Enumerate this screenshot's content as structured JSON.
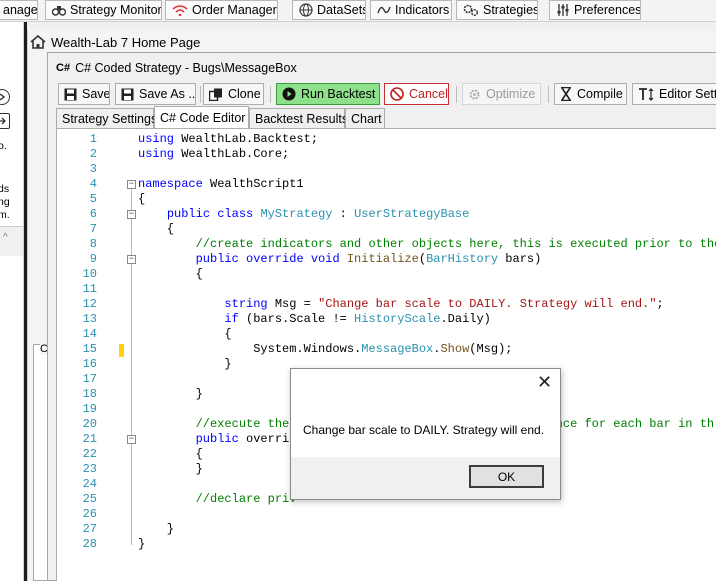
{
  "toolbar": [
    {
      "id": "order-manager-partial",
      "label": "anager",
      "icon": "none"
    },
    {
      "id": "strategy-monitor",
      "label": "Strategy Monitor",
      "icon": "binoculars-icon"
    },
    {
      "id": "order-manager",
      "label": "Order Manager",
      "icon": "wifi-icon"
    },
    {
      "id": "datasets",
      "label": "DataSets",
      "icon": "globe-icon"
    },
    {
      "id": "indicators",
      "label": "Indicators",
      "icon": "wave-icon"
    },
    {
      "id": "strategies",
      "label": "Strategies",
      "icon": "gears-icon"
    },
    {
      "id": "preferences",
      "label": "Preferences",
      "icon": "sliders-icon"
    }
  ],
  "left_panel": {
    "text_lines": [
      "o.",
      "ds",
      "ng",
      "m."
    ]
  },
  "home": {
    "title": "Wealth-Lab 7 Home Page",
    "group_label": "C"
  },
  "window": {
    "title": "C# Coded Strategy - Bugs\\MessageBox",
    "title_icon": "C#",
    "buttons": {
      "save": "Save",
      "save_as": "Save As ...",
      "clone": "Clone",
      "run": "Run Backtest",
      "cancel": "Cancel",
      "optimize": "Optimize",
      "compile": "Compile",
      "editor_settings": "Editor Settin"
    },
    "tabs": [
      "Strategy Settings",
      "C# Code Editor",
      "Backtest Results",
      "Chart"
    ],
    "active_tab": "C# Code Editor"
  },
  "code_lines": [
    {
      "n": "1",
      "text": "using WealthLab.Backtest;"
    },
    {
      "n": "2",
      "text": "using WealthLab.Core;"
    },
    {
      "n": "3",
      "text": ""
    },
    {
      "n": "4",
      "text": "namespace WealthScript1"
    },
    {
      "n": "5",
      "text": "{"
    },
    {
      "n": "6",
      "text": "    public class MyStrategy : UserStrategyBase"
    },
    {
      "n": "7",
      "text": "    {"
    },
    {
      "n": "8",
      "text": "        //create indicators and other objects here, this is executed prior to the m"
    },
    {
      "n": "9",
      "text": "        public override void Initialize(BarHistory bars)"
    },
    {
      "n": "10",
      "text": "        {"
    },
    {
      "n": "11",
      "text": ""
    },
    {
      "n": "12",
      "text": "            string Msg = \"Change bar scale to DAILY. Strategy will end.\";"
    },
    {
      "n": "13",
      "text": "            if (bars.Scale != HistoryScale.Daily)"
    },
    {
      "n": "14",
      "text": "            {"
    },
    {
      "n": "15",
      "text": "                System.Windows.MessageBox.Show(Msg);"
    },
    {
      "n": "16",
      "text": "            }"
    },
    {
      "n": "17",
      "text": ""
    },
    {
      "n": "18",
      "text": "        }"
    },
    {
      "n": "19",
      "text": ""
    },
    {
      "n": "20",
      "text": "        //execute the                                    once for each bar in th"
    },
    {
      "n": "21",
      "text": "        public overrid                                   k)"
    },
    {
      "n": "22",
      "text": "        {"
    },
    {
      "n": "23",
      "text": "        }"
    },
    {
      "n": "24",
      "text": ""
    },
    {
      "n": "25",
      "text": "        //declare priv"
    },
    {
      "n": "26",
      "text": ""
    },
    {
      "n": "27",
      "text": "    }"
    },
    {
      "n": "28",
      "text": "}"
    }
  ],
  "dialog": {
    "message": "Change bar scale to DAILY. Strategy will end.",
    "ok_label": "OK",
    "close_glyph": "✕"
  },
  "colors": {
    "keyword": "#0000ff",
    "type": "#2b91af",
    "comment": "#008000",
    "string": "#a31515",
    "method": "#74531f",
    "run_button": "#8fe08a",
    "cancel_button_border": "#c93030",
    "breakpoint_marker": "#ffd10a"
  }
}
